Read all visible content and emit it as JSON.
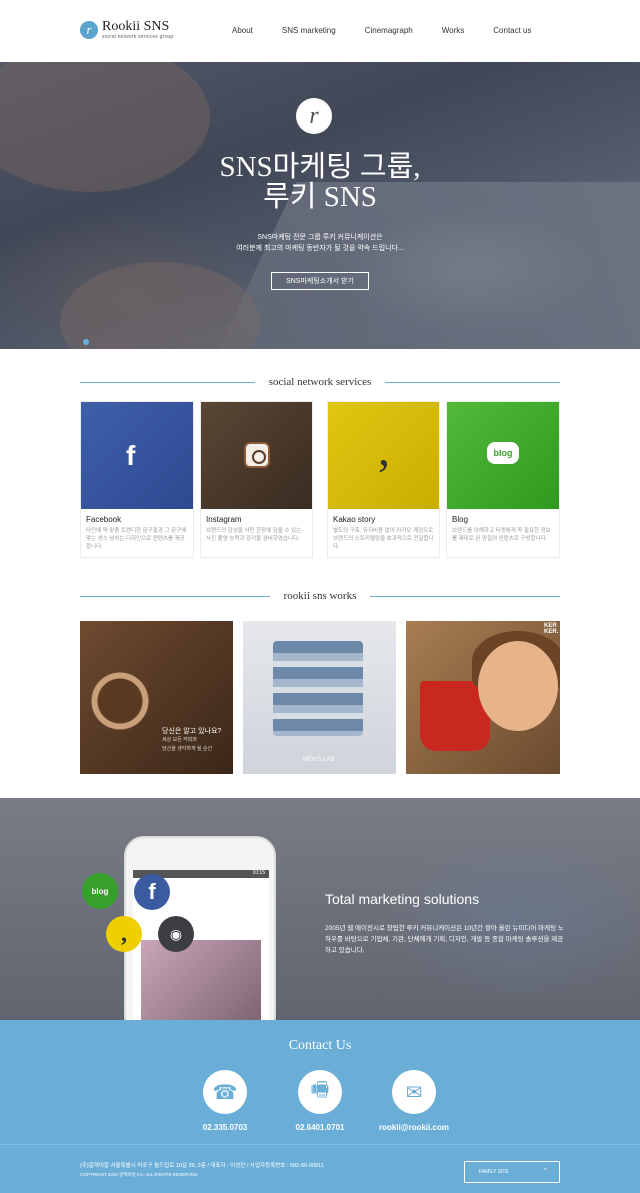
{
  "header": {
    "logo_mark": "r",
    "logo_name": "Rookii SNS",
    "logo_sub": "social network services group",
    "nav": [
      "About",
      "SNS marketing",
      "Cinemagraph",
      "Works",
      "Contact us"
    ]
  },
  "hero": {
    "logo_mark": "r",
    "title_line1": "SNS마케팅 그룹,",
    "title_line2": "루키 SNS",
    "desc_line1": "SNS마케팅 전문 그룹 루키 커뮤니케이션은",
    "desc_line2": "여러분께 최고의 마케팅 동반자가 될 것을 약속 드립니다...",
    "button": "SNS마케팅소개서 받기"
  },
  "sns_section": {
    "title": "social network services",
    "cards": [
      {
        "name": "Facebook",
        "desc": "타인에 딱 맞춤 트랜디한 문구들과 그 문구에 맞는 센스 넘치는 디자인으로 컨텐츠를 제공합니다."
      },
      {
        "name": "Instagram",
        "desc": "브랜드의 감성을 사진 한장에 담을 수 있는 사진 촬영 능력과 감각을 겸비하였습니다."
      },
      {
        "name": "Kakao story",
        "desc": "별도의 구축, 유지비용 없이 카카오 계정으로 브랜드의 스토리텔링을 효과적으로 전달합니다."
      },
      {
        "name": "Blog",
        "desc": "브랜드를 이해하고 타겟에게 꼭 필요한 정보를 제대로 된 양질의 컨텐츠로 구성합니다."
      }
    ]
  },
  "works_section": {
    "title": "rookii sns works",
    "work1_caption": "당신은 알고 있나요?",
    "work1_sub1": "세상 모든 커피와",
    "work1_sub2": "당신을 생각하게 될 순간",
    "work2_tag": "MEN'S LAB",
    "work3_tag1": "KER",
    "work3_tag2": "KER."
  },
  "marketing": {
    "title": "Total marketing solutions",
    "desc": "2005년 웹 에이전시로 창립한 루키 커뮤니케이션은 10년간 쌓아 올린 뉴미디어 마케팅 노하우를 바탕으로 기업체, 기관, 단체에게 기획, 디자인, 개발 등 종합 마케팅 솔루션을 제공하고 있습니다.",
    "phone_time": "10:15",
    "bubble_blog": "blog",
    "bubble_fb": "f",
    "bubble_kakao": ",",
    "bubble_ig": "◉"
  },
  "contact": {
    "title": "Contact Us",
    "phone": "02.335.0703",
    "fax": "02.6401.0701",
    "email": "rookii@rookii.com"
  },
  "footer": {
    "address": "(주)알게이알 서울특별시 마포구 월드컵로 10길 39, 2층 / 대표자 : 이성진 / 사업자등록번호 : 682-86-00811",
    "copyright": "COPYRIGHT 2016 알케이알 Inc. ALL RIGHTS RESERVED.",
    "family_site": "FAMILY SITE"
  }
}
